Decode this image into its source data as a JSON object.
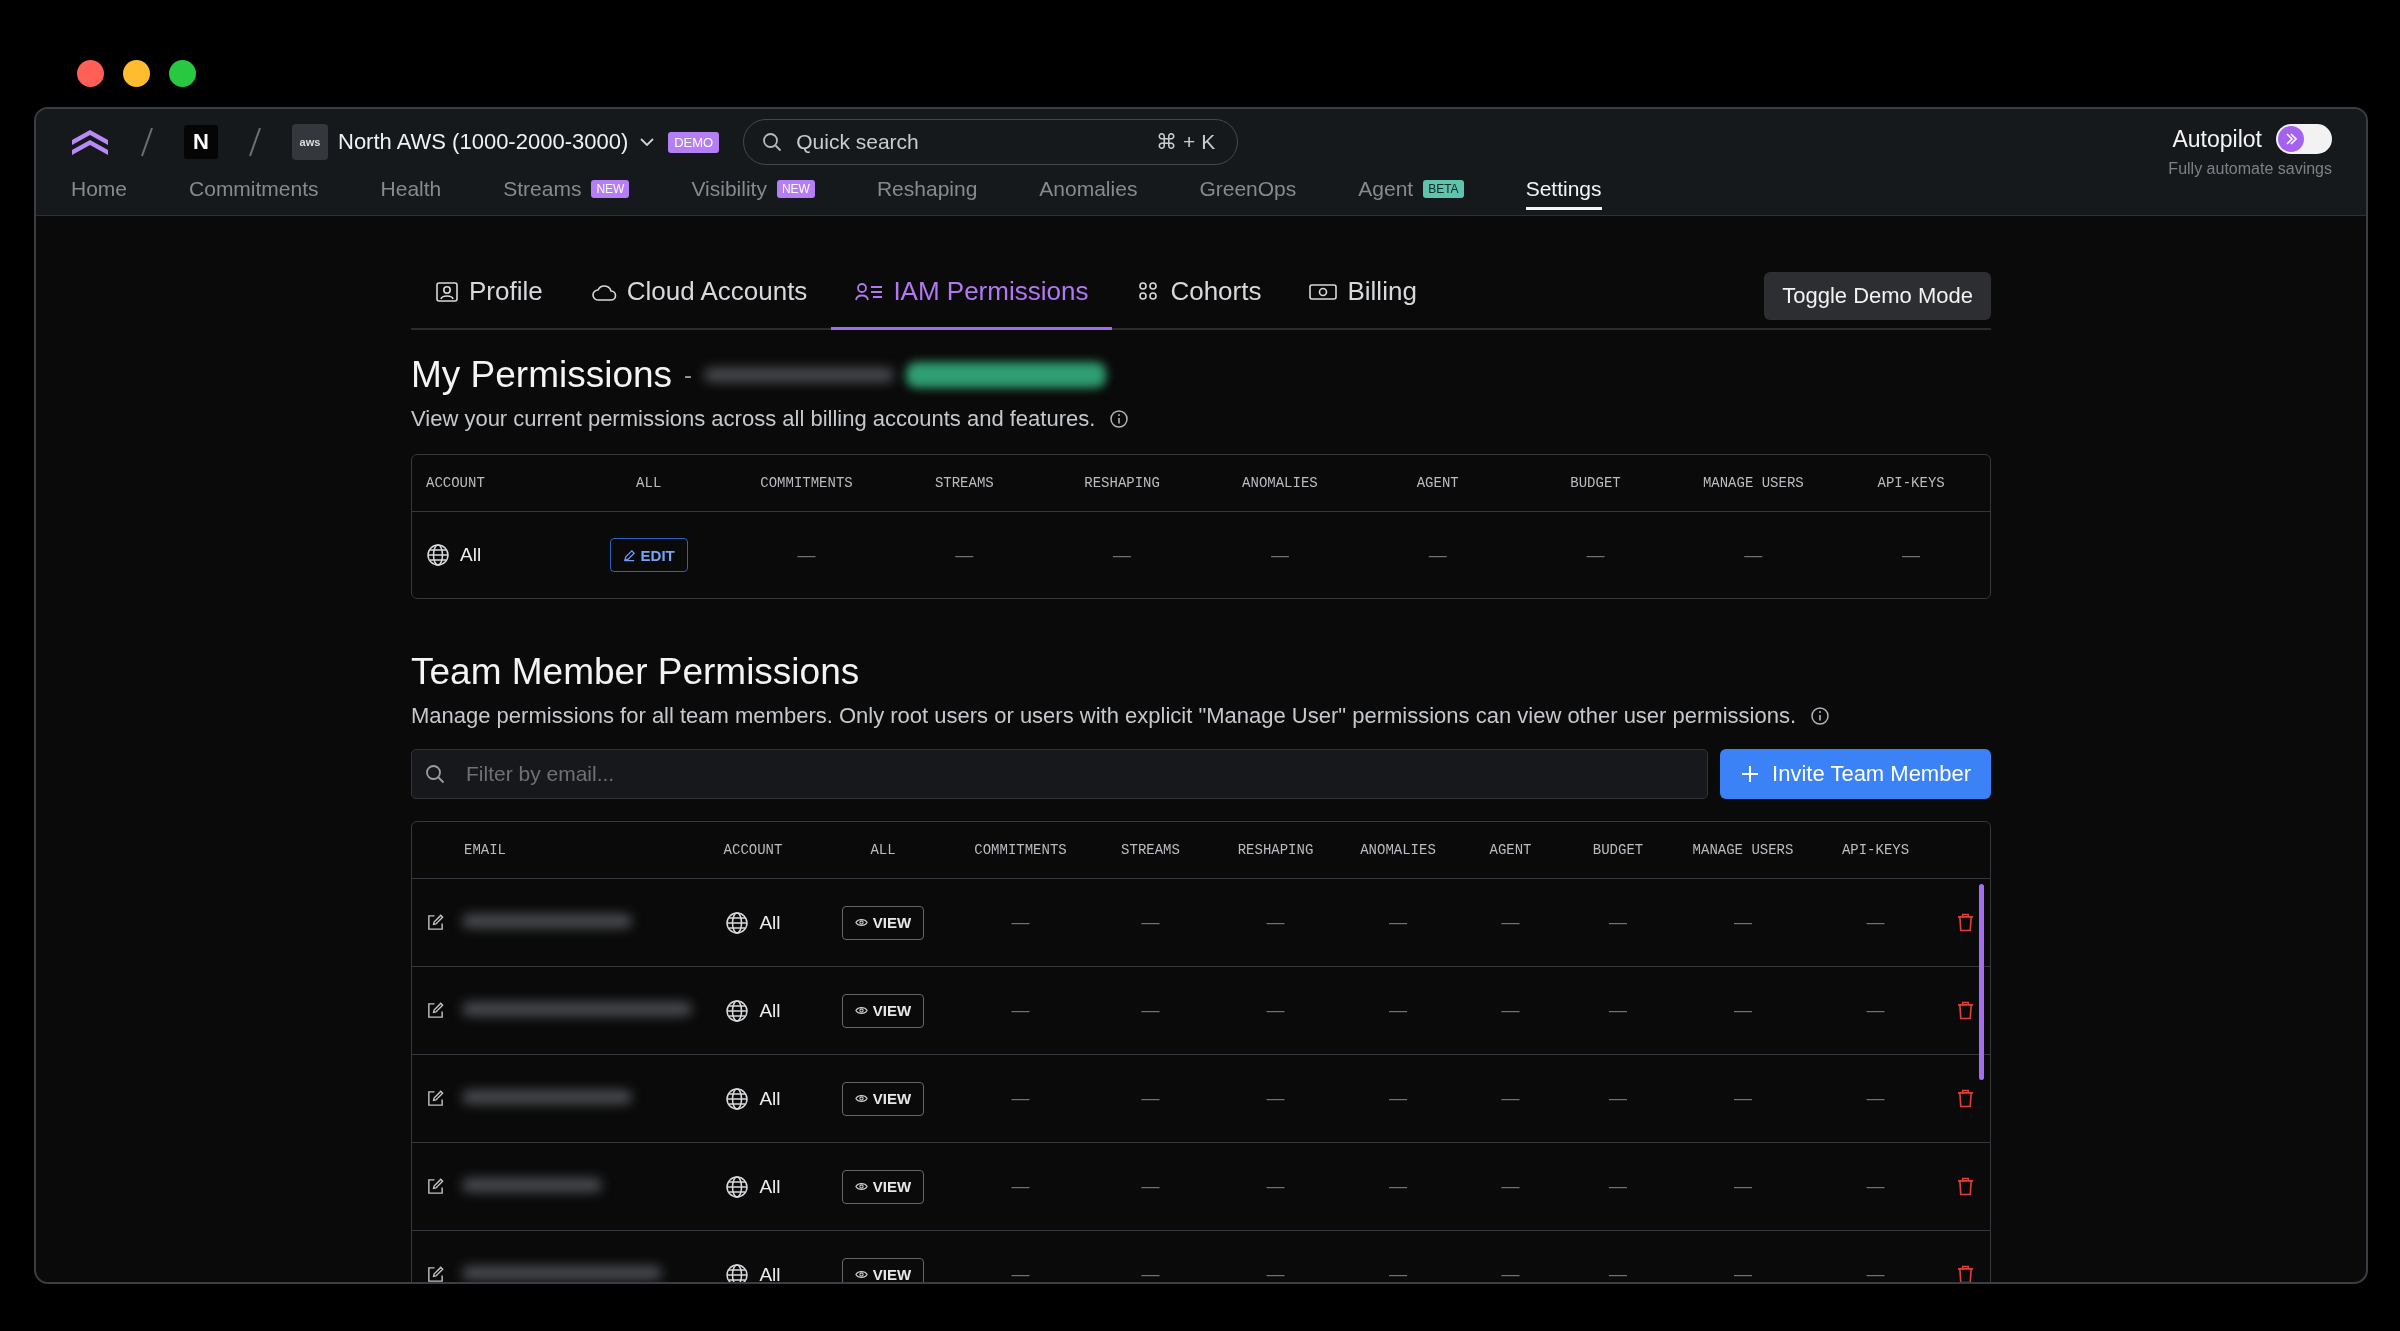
{
  "header": {
    "org_initial": "N",
    "account": {
      "logo": "aws",
      "name": "North AWS (1000-2000-3000)",
      "badge": "DEMO"
    },
    "search": {
      "placeholder": "Quick search",
      "shortcut": "⌘ + K"
    },
    "autopilot": {
      "label": "Autopilot",
      "subtitle": "Fully automate savings",
      "on": false
    }
  },
  "nav": [
    {
      "label": "Home",
      "selected": false
    },
    {
      "label": "Commitments",
      "selected": false
    },
    {
      "label": "Health",
      "selected": false
    },
    {
      "label": "Streams",
      "selected": false,
      "badge": {
        "text": "NEW",
        "color": "#b57ef5"
      }
    },
    {
      "label": "Visibility",
      "selected": false,
      "badge": {
        "text": "NEW",
        "color": "#b57ef5"
      }
    },
    {
      "label": "Reshaping",
      "selected": false
    },
    {
      "label": "Anomalies",
      "selected": false
    },
    {
      "label": "GreenOps",
      "selected": false
    },
    {
      "label": "Agent",
      "selected": false,
      "badge": {
        "text": "BETA",
        "color": "#5ec4ad"
      }
    },
    {
      "label": "Settings",
      "selected": true
    }
  ],
  "settings_tabs": [
    {
      "label": "Profile",
      "selected": false
    },
    {
      "label": "Cloud Accounts",
      "selected": false
    },
    {
      "label": "IAM Permissions",
      "selected": true
    },
    {
      "label": "Cohorts",
      "selected": false
    },
    {
      "label": "Billing",
      "selected": false
    }
  ],
  "toggle_demo_button": "Toggle Demo Mode",
  "my_permissions": {
    "title": "My Permissions",
    "separator": "-",
    "subtitle": "View your current permissions across all billing accounts and features.",
    "table": {
      "columns": [
        "ACCOUNT",
        "ALL",
        "COMMITMENTS",
        "STREAMS",
        "RESHAPING",
        "ANOMALIES",
        "AGENT",
        "BUDGET",
        "MANAGE USERS",
        "API-KEYS"
      ],
      "rows": [
        {
          "cells": [
            "All",
            "EDIT",
            "—",
            "—",
            "—",
            "—",
            "—",
            "—",
            "—",
            "—"
          ]
        }
      ]
    }
  },
  "team_permissions": {
    "title": "Team Member Permissions",
    "subtitle": "Manage permissions for all team members. Only root users or users with explicit \"Manage User\" permissions can view other user permissions.",
    "filter": {
      "placeholder": "Filter by email..."
    },
    "invite_button": "Invite Team Member",
    "table": {
      "columns": [
        "EMAIL",
        "ACCOUNT",
        "ALL",
        "COMMITMENTS",
        "STREAMS",
        "RESHAPING",
        "ANOMALIES",
        "AGENT",
        "BUDGET",
        "MANAGE USERS",
        "API-KEYS"
      ],
      "rows": [
        {
          "cells": [
            "",
            "All",
            "VIEW",
            "—",
            "—",
            "—",
            "—",
            "—",
            "—",
            "—",
            "—"
          ]
        },
        {
          "cells": [
            "",
            "All",
            "VIEW",
            "—",
            "—",
            "—",
            "—",
            "—",
            "—",
            "—",
            "—"
          ]
        },
        {
          "cells": [
            "",
            "All",
            "VIEW",
            "—",
            "—",
            "—",
            "—",
            "—",
            "—",
            "—",
            "—"
          ]
        },
        {
          "cells": [
            "",
            "All",
            "VIEW",
            "—",
            "—",
            "—",
            "—",
            "—",
            "—",
            "—",
            "—"
          ]
        },
        {
          "cells": [
            "",
            "All",
            "VIEW",
            "—",
            "—",
            "—",
            "—",
            "—",
            "—",
            "—",
            "—"
          ]
        }
      ]
    }
  }
}
